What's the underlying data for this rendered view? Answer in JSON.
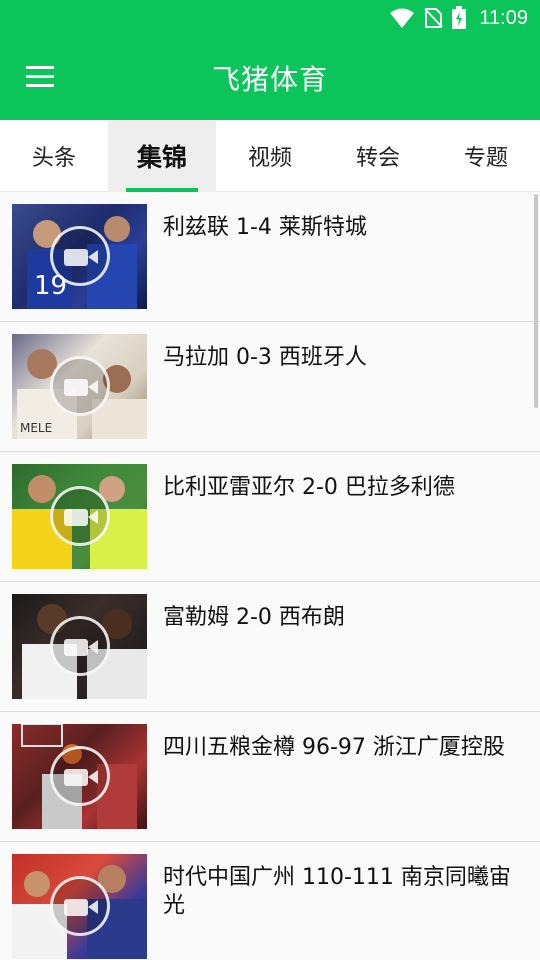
{
  "status_bar": {
    "time": "11:09",
    "icons": [
      "wifi-icon",
      "no-sim-icon",
      "battery-charging-icon"
    ]
  },
  "header": {
    "title": "飞猪体育",
    "menu_icon": "menu-icon"
  },
  "tabs": [
    {
      "label": "头条",
      "active": false
    },
    {
      "label": "集锦",
      "active": true
    },
    {
      "label": "视频",
      "active": false
    },
    {
      "label": "转会",
      "active": false
    },
    {
      "label": "专题",
      "active": false
    }
  ],
  "videos": [
    {
      "title": "利兹联 1-4 莱斯特城"
    },
    {
      "title": "马拉加 0-3 西班牙人"
    },
    {
      "title": "比利亚雷亚尔 2-0 巴拉多利德"
    },
    {
      "title": "富勒姆 2-0 西布朗"
    },
    {
      "title": "四川五粮金樽 96-97 浙江广厦控股"
    },
    {
      "title": "时代中国广州 110-111 南京同曦宙光"
    }
  ],
  "colors": {
    "brand": "#0bc55a",
    "tab_active_bg": "#eeeeee"
  }
}
